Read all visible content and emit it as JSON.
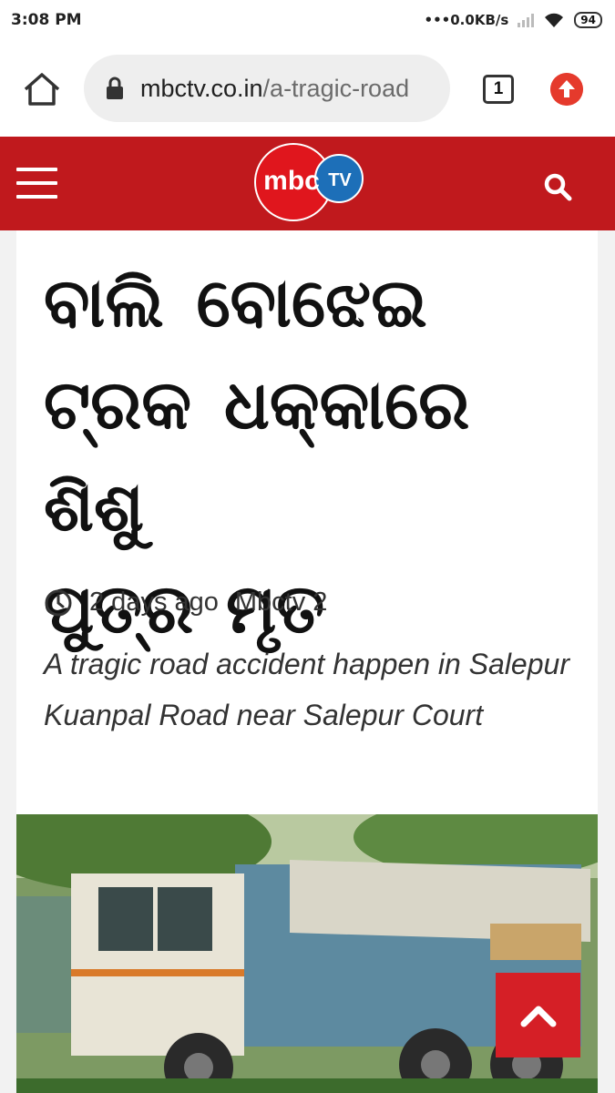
{
  "status_bar": {
    "time": "3:08 PM",
    "net_speed": "0.0KB/s",
    "battery": "94"
  },
  "browser": {
    "url_host": "mbctv.co.in",
    "url_path": "/a-tragic-road",
    "tab_count": "1",
    "icons": [
      "home-icon",
      "lock-icon",
      "tabs-icon",
      "update-icon"
    ]
  },
  "site": {
    "logo_text": "mbc",
    "logo_tv": "TV",
    "brand_color": "#c0191d",
    "icons": [
      "menu-icon",
      "search-icon"
    ]
  },
  "article": {
    "headline_lines": [
      "ବାଲି ବୋଝେଇ",
      "ଟ୍ରକ ଧକ୍କାରେ ଶିଶୁ",
      "ପୁତ୍ର ମୃତ"
    ],
    "time_ago": "2 days ago",
    "author": "Mbctv 2",
    "summary": "A tragic road accident happen in Salepur Kuanpal Road near Salepur Court"
  }
}
